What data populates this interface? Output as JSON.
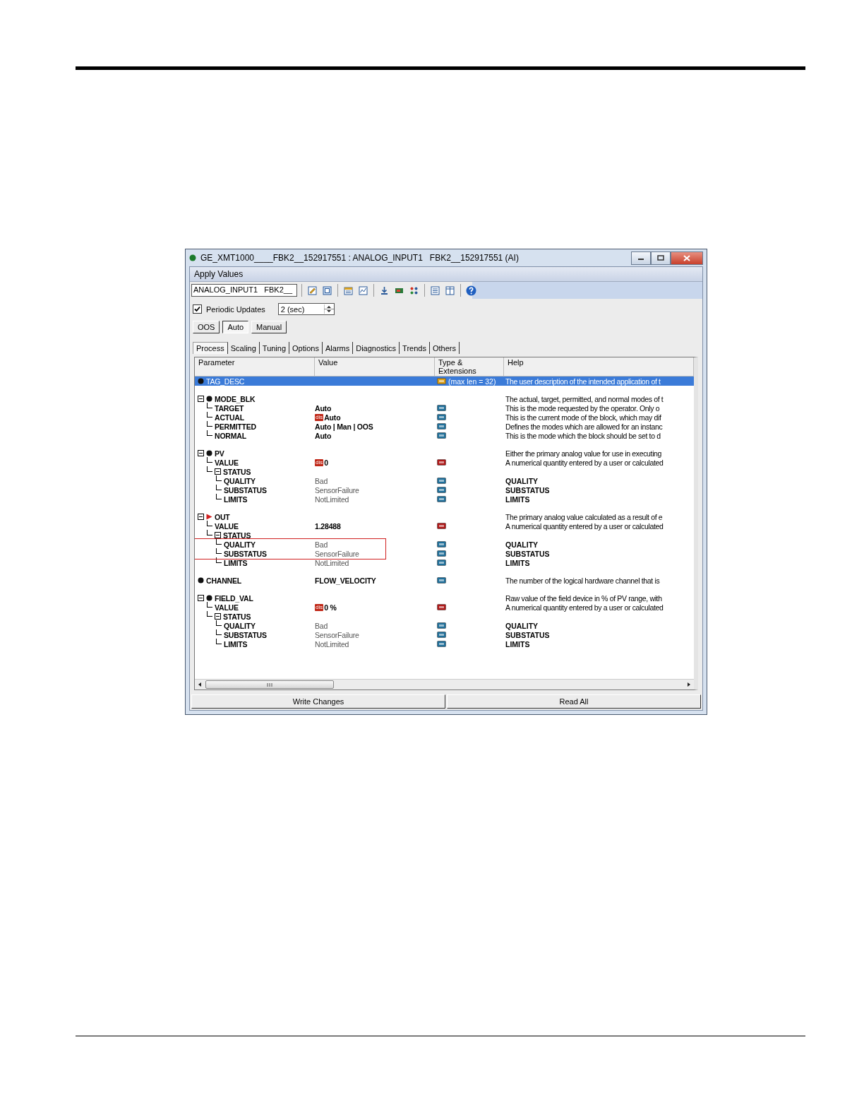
{
  "window": {
    "title": "GE_XMT1000____FBK2__152917551 : ANALOG_INPUT1   FBK2__152917551 (AI)"
  },
  "menu": {
    "label": "Apply Values"
  },
  "toolbar": {
    "block_field": "ANALOG_INPUT1   FBK2__"
  },
  "periodic_updates": {
    "label": "Periodic Updates",
    "checked": true,
    "interval": "2 (sec)"
  },
  "modes": [
    {
      "label": "OOS",
      "selected": false
    },
    {
      "label": "Auto",
      "selected": true
    },
    {
      "label": "Manual",
      "selected": false
    }
  ],
  "tabs": [
    {
      "label": "Process",
      "selected": true
    },
    {
      "label": "Scaling",
      "selected": false
    },
    {
      "label": "Tuning",
      "selected": false
    },
    {
      "label": "Options",
      "selected": false
    },
    {
      "label": "Alarms",
      "selected": false
    },
    {
      "label": "Diagnostics",
      "selected": false
    },
    {
      "label": "Trends",
      "selected": false
    },
    {
      "label": "Others",
      "selected": false
    }
  ],
  "table": {
    "columns": [
      "Parameter",
      "Value",
      "Type & Extensions",
      "Help"
    ],
    "rows": [
      {
        "name": "TAG_DESC",
        "marker": {
          "kind": "dot"
        },
        "selected": true,
        "type": {
          "kind": "string"
        },
        "type_text": "(max len = 32)",
        "help": "The user description of the intended application of t"
      },
      {
        "name": "MODE_BLK",
        "marker": {
          "kind": "dot"
        },
        "selected": false,
        "expanded": true,
        "help": "The actual, target, permitted, and normal modes of t",
        "children": [
          {
            "name": "TARGET",
            "value": "Auto",
            "dimmed": false,
            "selected": false,
            "type": {
              "kind": "enum"
            },
            "help": "This is the mode requested by the operator.  Only o"
          },
          {
            "name": "ACTUAL",
            "badge": "dis",
            "value": "Auto",
            "dimmed": false,
            "selected": false,
            "type": {
              "kind": "enum"
            },
            "help": "This is the current mode of the block, which may dif"
          },
          {
            "name": "PERMITTED",
            "value": "Auto | Man | OOS",
            "dimmed": false,
            "selected": false,
            "type": {
              "kind": "enum"
            },
            "help": "Defines the modes which are allowed for an instanc"
          },
          {
            "name": "NORMAL",
            "value": "Auto",
            "dimmed": false,
            "selected": false,
            "type": {
              "kind": "enum"
            },
            "help": "This is the mode which the block should be set to d"
          }
        ]
      },
      {
        "name": "PV",
        "marker": {
          "kind": "dot"
        },
        "selected": false,
        "expanded": true,
        "help": "Either the primary analog value for use in executing",
        "children": [
          {
            "name": "VALUE",
            "badge": "dis",
            "value": "0",
            "dimmed": false,
            "selected": false,
            "type": {
              "kind": "float"
            },
            "help": "A numerical quantity entered by a user or calculated"
          },
          {
            "name": "STATUS",
            "selected": false,
            "expanded": true,
            "children": [
              {
                "name": "QUALITY",
                "value": "Bad",
                "dimmed": true,
                "selected": false,
                "type": {
                  "kind": "enum"
                },
                "help": "QUALITY"
              },
              {
                "name": "SUBSTATUS",
                "value": "SensorFailure",
                "dimmed": true,
                "selected": false,
                "type": {
                  "kind": "enum"
                },
                "help": "SUBSTATUS"
              },
              {
                "name": "LIMITS",
                "value": "NotLimited",
                "dimmed": true,
                "selected": false,
                "type": {
                  "kind": "enum"
                },
                "help": "LIMITS"
              }
            ]
          }
        ]
      },
      {
        "name": "OUT",
        "marker": {
          "kind": "flag"
        },
        "selected": false,
        "expanded": true,
        "help": "The primary analog value calculated as a result of e",
        "children": [
          {
            "name": "VALUE",
            "value": "1.28488",
            "dimmed": false,
            "selected": false,
            "type": {
              "kind": "float"
            },
            "help": "A numerical quantity entered by a user or calculated"
          },
          {
            "name": "STATUS",
            "selected": false,
            "expanded": true,
            "children": [
              {
                "name": "QUALITY",
                "value": "Bad",
                "dimmed": true,
                "selected": false,
                "highlighted": true,
                "type": {
                  "kind": "enum"
                },
                "help": "QUALITY"
              },
              {
                "name": "SUBSTATUS",
                "value": "SensorFailure",
                "dimmed": true,
                "selected": false,
                "highlighted": true,
                "type": {
                  "kind": "enum"
                },
                "help": "SUBSTATUS"
              },
              {
                "name": "LIMITS",
                "value": "NotLimited",
                "dimmed": true,
                "selected": false,
                "highlighted": false,
                "type": {
                  "kind": "enum"
                },
                "help": "LIMITS"
              }
            ]
          }
        ]
      },
      {
        "name": "CHANNEL",
        "marker": {
          "kind": "dot"
        },
        "value": "FLOW_VELOCITY",
        "dimmed": false,
        "selected": false,
        "type": {
          "kind": "enum"
        },
        "help": "The number of the logical hardware channel that is"
      },
      {
        "name": "FIELD_VAL",
        "marker": {
          "kind": "dot"
        },
        "selected": false,
        "expanded": true,
        "help": "Raw value of the field device in % of PV range, with",
        "children": [
          {
            "name": "VALUE",
            "badge": "dis",
            "value": "0 %",
            "dimmed": false,
            "selected": false,
            "type": {
              "kind": "float"
            },
            "help": "A numerical quantity entered by a user or calculated"
          },
          {
            "name": "STATUS",
            "selected": false,
            "expanded": true,
            "children": [
              {
                "name": "QUALITY",
                "value": "Bad",
                "dimmed": true,
                "selected": false,
                "type": {
                  "kind": "enum"
                },
                "help": "QUALITY"
              },
              {
                "name": "SUBSTATUS",
                "value": "SensorFailure",
                "dimmed": true,
                "selected": false,
                "type": {
                  "kind": "enum"
                },
                "help": "SUBSTATUS"
              },
              {
                "name": "LIMITS",
                "value": "NotLimited",
                "dimmed": true,
                "selected": false,
                "type": {
                  "kind": "enum"
                },
                "help": "LIMITS"
              }
            ]
          }
        ]
      }
    ]
  },
  "buttons": [
    {
      "label": "Write Changes"
    },
    {
      "label": "Read All"
    }
  ]
}
